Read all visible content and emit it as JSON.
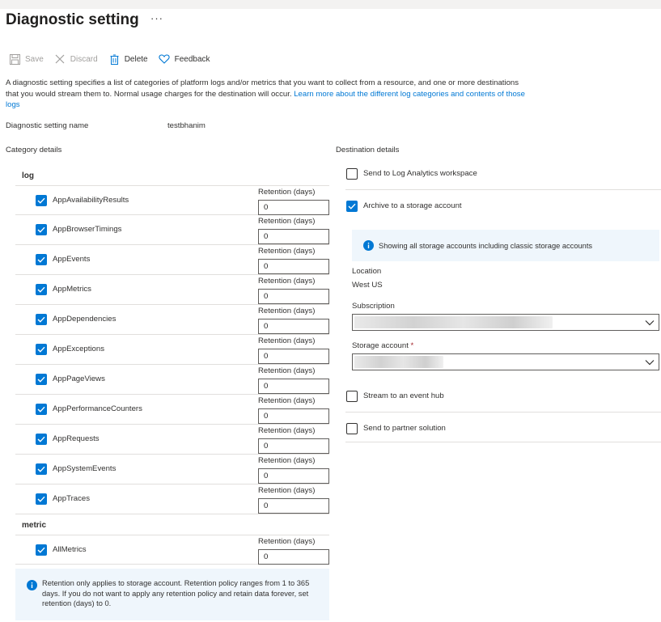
{
  "page": {
    "title": "Diagnostic setting",
    "more": "···"
  },
  "toolbar": {
    "save_label": "Save",
    "discard_label": "Discard",
    "delete_label": "Delete",
    "feedback_label": "Feedback"
  },
  "description": {
    "text": "A diagnostic setting specifies a list of categories of platform logs and/or metrics that you want to collect from a resource, and one or more destinations that you would stream them to. Normal usage charges for the destination will occur. ",
    "link": "Learn more about the different log categories and contents of those logs"
  },
  "setting_name": {
    "label": "Diagnostic setting name",
    "value": "testbhanim"
  },
  "category": {
    "label": "Category details",
    "retention_label": "Retention (days)",
    "log_title": "log",
    "logs": [
      {
        "name": "AppAvailabilityResults",
        "checked": true,
        "retention": "0"
      },
      {
        "name": "AppBrowserTimings",
        "checked": true,
        "retention": "0"
      },
      {
        "name": "AppEvents",
        "checked": true,
        "retention": "0"
      },
      {
        "name": "AppMetrics",
        "checked": true,
        "retention": "0"
      },
      {
        "name": "AppDependencies",
        "checked": true,
        "retention": "0"
      },
      {
        "name": "AppExceptions",
        "checked": true,
        "retention": "0"
      },
      {
        "name": "AppPageViews",
        "checked": true,
        "retention": "0"
      },
      {
        "name": "AppPerformanceCounters",
        "checked": true,
        "retention": "0"
      },
      {
        "name": "AppRequests",
        "checked": true,
        "retention": "0"
      },
      {
        "name": "AppSystemEvents",
        "checked": true,
        "retention": "0"
      },
      {
        "name": "AppTraces",
        "checked": true,
        "retention": "0"
      }
    ],
    "metric_title": "metric",
    "metrics": [
      {
        "name": "AllMetrics",
        "checked": true,
        "retention": "0"
      }
    ],
    "info": "Retention only applies to storage account. Retention policy ranges from 1 to 365 days. If you do not want to apply any retention policy and retain data forever, set retention (days) to 0."
  },
  "destination": {
    "label": "Destination details",
    "log_analytics": {
      "label": "Send to Log Analytics workspace",
      "checked": false
    },
    "storage": {
      "label": "Archive to a storage account",
      "checked": true
    },
    "storage_info": "Showing all storage accounts including classic storage accounts",
    "location_label": "Location",
    "location_value": "West US",
    "subscription_label": "Subscription",
    "storage_account_label": "Storage account",
    "required_mark": "*",
    "event_hub": {
      "label": "Stream to an event hub",
      "checked": false
    },
    "partner": {
      "label": "Send to partner solution",
      "checked": false
    }
  },
  "colors": {
    "accent": "#0078d4",
    "info_bg": "#eff6fc",
    "divider": "#e1dfdd",
    "required": "#a4262c"
  },
  "icons": [
    "save-icon",
    "discard-icon",
    "delete-icon",
    "feedback-icon",
    "info-icon",
    "chevron-down-icon",
    "checkmark-icon"
  ]
}
